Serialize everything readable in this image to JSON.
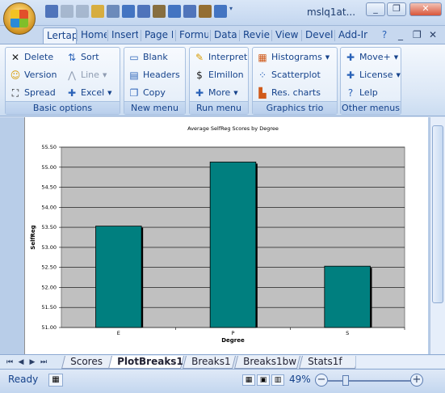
{
  "window": {
    "title": "mslq1at...",
    "qat_icons": [
      "save-icon",
      "undo-icon",
      "redo-icon",
      "open-icon",
      "print-preview-icon",
      "chart-icon",
      "grid-icon",
      "tally-icon",
      "chart-icon",
      "grid-icon",
      "eraser-icon",
      "pen-icon",
      "customize-icon"
    ],
    "controls": [
      "minimize-icon",
      "restore-icon",
      "close-icon"
    ],
    "control_glyphs": [
      "_",
      "❐",
      "✕"
    ]
  },
  "tabs": [
    {
      "label": "Lertap",
      "active": true
    },
    {
      "label": "Home"
    },
    {
      "label": "Insert"
    },
    {
      "label": "Page L"
    },
    {
      "label": "Formu"
    },
    {
      "label": "Data"
    },
    {
      "label": "Reviev"
    },
    {
      "label": "View"
    },
    {
      "label": "Develc"
    },
    {
      "label": "Add-Ir"
    }
  ],
  "ribbon_right_glyphs": [
    "?",
    "_",
    "❐",
    "✕"
  ],
  "groups": [
    {
      "title": "Basic options",
      "buttons": [
        {
          "label": "Delete",
          "icon": "x-icon",
          "glyph": "✕",
          "color": "#1a1a1a"
        },
        {
          "label": "Version",
          "icon": "smiley-icon",
          "glyph": "☺",
          "color": "#d79a00"
        },
        {
          "label": "Spread",
          "icon": "spread-icon",
          "glyph": "⛶",
          "color": "#1a1a1a"
        },
        {
          "label": "Sort",
          "icon": "sort-icon",
          "glyph": "⇅",
          "color": "#2a62b8"
        },
        {
          "label": "Line",
          "icon": "line-icon",
          "glyph": "⋀",
          "color": "#8f9cb2",
          "disabled": true,
          "dropdown": true
        },
        {
          "label": "Excel",
          "icon": "plus-icon",
          "glyph": "✚",
          "color": "#2a62b8",
          "dropdown": true
        }
      ]
    },
    {
      "title": "New menu",
      "buttons": [
        {
          "label": "Blank",
          "icon": "blank-page-icon",
          "glyph": "▭",
          "color": "#2a62b8"
        },
        {
          "label": "Headers",
          "icon": "headers-icon",
          "glyph": "▤",
          "color": "#2a62b8"
        },
        {
          "label": "Copy",
          "icon": "copy-icon",
          "glyph": "❐",
          "color": "#2a62b8"
        }
      ]
    },
    {
      "title": "Run menu",
      "buttons": [
        {
          "label": "Interpret",
          "icon": "interpret-icon",
          "glyph": "✎",
          "color": "#d79a00"
        },
        {
          "label": "Elmillon",
          "icon": "dollar-icon",
          "glyph": "$",
          "color": "#1a1a1a"
        },
        {
          "label": "More",
          "icon": "plus-icon",
          "glyph": "✚",
          "color": "#2a62b8",
          "dropdown": true
        }
      ]
    },
    {
      "title": "Graphics trio",
      "buttons": [
        {
          "label": "Histograms",
          "icon": "histogram-icon",
          "glyph": "▦",
          "color": "#d05a1a",
          "dropdown": true
        },
        {
          "label": "Scatterplot",
          "icon": "scatterplot-icon",
          "glyph": "⁘",
          "color": "#2a62b8"
        },
        {
          "label": "Res. charts",
          "icon": "res-chart-icon",
          "glyph": "▙",
          "color": "#d05a1a"
        }
      ]
    },
    {
      "title": "Other menus",
      "buttons": [
        {
          "label": "Move+",
          "icon": "plus-icon",
          "glyph": "✚",
          "color": "#2a62b8",
          "dropdown": true
        },
        {
          "label": "License",
          "icon": "plus-icon",
          "glyph": "✚",
          "color": "#2a62b8",
          "dropdown": true
        },
        {
          "label": "Lelp",
          "icon": "help-icon",
          "glyph": "?",
          "color": "#2a62b8"
        }
      ]
    }
  ],
  "chart_data": {
    "type": "bar",
    "title": "Average SelfReg Scores by Degree",
    "xlabel": "Degree",
    "ylabel": "SelfReg",
    "categories": [
      "E",
      "P",
      "S"
    ],
    "values": [
      53.53,
      55.13,
      52.53
    ],
    "ylim": [
      51.0,
      55.5
    ],
    "yticks": [
      "51.00",
      "51.50",
      "52.00",
      "52.50",
      "53.00",
      "53.50",
      "54.00",
      "54.50",
      "55.00",
      "55.50"
    ],
    "grid": true,
    "bar_color": "#007f7f",
    "plot_bg": "#c0c0c0"
  },
  "sheet_tabs": [
    {
      "label": "Scores"
    },
    {
      "label": "PlotBreaks1",
      "active": true
    },
    {
      "label": "Breaks1"
    },
    {
      "label": "Breaks1bw"
    },
    {
      "label": "Stats1f"
    }
  ],
  "nav_glyphs": [
    "⏮",
    "◀",
    "▶",
    "⏭"
  ],
  "status": {
    "ready": "Ready",
    "zoom": "49%",
    "view_glyphs": [
      "▦",
      "▣",
      "▥"
    ]
  }
}
